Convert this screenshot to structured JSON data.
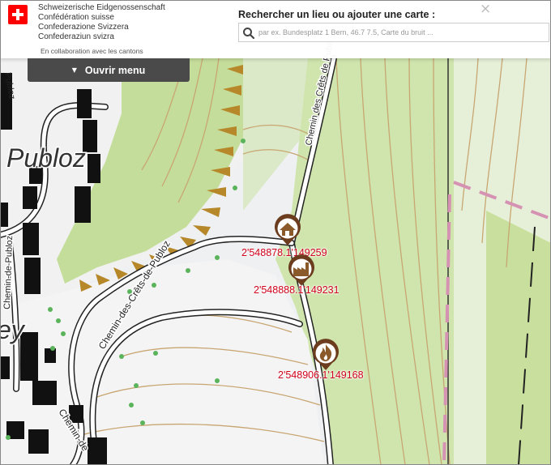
{
  "header": {
    "confederation": [
      "Schweizerische Eidgenossenschaft",
      "Confédération suisse",
      "Confederazione Svizzera",
      "Confederaziun svizra"
    ],
    "cantons_text": "En collaboration avec les cantons",
    "search_title": "Rechercher un lieu ou ajouter une carte :",
    "search_placeholder": "par ex. Bundesplatz 1 Bern, 46.7 7.5, Carte du bruit ...",
    "close_symbol": "×"
  },
  "menu": {
    "label": "Ouvrir menu",
    "chevron": "▼"
  },
  "map": {
    "streets": {
      "cretes": "Chemin-des-Crêts-de-Publoz",
      "cretes_short": "Chemin des Crêts de Publoz",
      "publoz_vertical": "Chemin-de-Publoz",
      "place": "Publoz",
      "bottom": "Chemin-de",
      "ey": "ey"
    },
    "colors": {
      "accent_red": "#d0021b",
      "marker_brown": "#6b3c1e",
      "meadow": "#cde3a8",
      "forest": "#b9d891"
    },
    "markers": [
      {
        "icon": "house-icon",
        "label": "2'548878.1'149259"
      },
      {
        "icon": "factory-icon",
        "label": "2'548888.1'149231"
      },
      {
        "icon": "fire-icon",
        "label": "2'548906.1'149168"
      }
    ]
  }
}
